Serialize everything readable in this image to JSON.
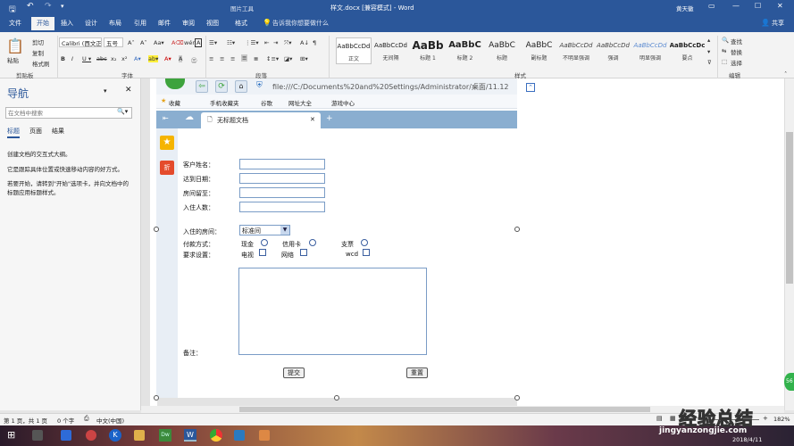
{
  "titlebar": {
    "quick_save": "🖫",
    "undo": "↶",
    "redo": "↷",
    "picture_tools": "图片工具",
    "doc_title": "样文.docx [兼容模式] - Word",
    "user": "黄天徽",
    "restore": "▭",
    "minimize": "—",
    "maximize": "☐",
    "close": "✕"
  },
  "tabs": {
    "file": "文件",
    "home": "开始",
    "insert": "插入",
    "design": "设计",
    "layout": "布局",
    "references": "引用",
    "mailings": "邮件",
    "review": "审阅",
    "view": "视图",
    "format": "格式",
    "tell_me": "告诉我你想要做什么",
    "share": "共享"
  },
  "ribbon": {
    "paste": "粘贴",
    "cut": "剪切",
    "copy": "复制",
    "format_painter": "格式刷",
    "clipboard": "剪贴板",
    "font_name": "Calibri (西文正",
    "font_size": "五号",
    "font_group": "字体",
    "paragraph_group": "段落",
    "styles_group": "样式",
    "editing_group": "编辑",
    "find": "查找",
    "replace": "替换",
    "select": "选择",
    "styles": [
      {
        "preview": "AaBbCcDd",
        "label": "正文"
      },
      {
        "preview": "AaBbCcDd",
        "label": "无间隔"
      },
      {
        "preview": "AaBb",
        "label": "标题 1"
      },
      {
        "preview": "AaBbC",
        "label": "标题 2"
      },
      {
        "preview": "AaBbC",
        "label": "标题"
      },
      {
        "preview": "AaBbC",
        "label": "副标题"
      },
      {
        "preview": "AaBbCcDd",
        "label": "不明显强调"
      },
      {
        "preview": "AaBbCcDd",
        "label": "强调"
      },
      {
        "preview": "AaBbCcDd",
        "label": "明显强调"
      },
      {
        "preview": "AaBbCcDc",
        "label": "要点"
      }
    ]
  },
  "nav": {
    "title": "导航",
    "search_placeholder": "在文档中搜索",
    "tab_headings": "标题",
    "tab_pages": "页面",
    "tab_results": "结果",
    "text1": "创建文档的交互式大纲。",
    "text2": "它是跟踪具体位置或快速移动内容的好方式。",
    "text3": "若要开始，请转到\"开始\"选项卡，并向文档中的标题应用标题样式。"
  },
  "browser": {
    "address": "file:///C:/Documents%20and%20Settings/Administrator/桌面/11.12",
    "fav_favorites": "收藏",
    "fav_mobile": "手机收藏夹",
    "fav_google": "谷歌",
    "fav_sites": "网址大全",
    "fav_games": "游戏中心",
    "tab_title": "无标题文档",
    "tab_close": "✕",
    "tab_new": "+"
  },
  "form": {
    "name_label": "客户姓名：",
    "arrival_label": "达到日期：",
    "room_label": "房间留至：",
    "guests_label": "入住人数：",
    "room_type_label": "入住的房间：",
    "room_type_value": "标准间",
    "payment_label": "付款方式：",
    "pay_cash": "现金",
    "pay_card": "信用卡",
    "pay_check": "支票",
    "req_label": "要求设置：",
    "req_tv": "电视",
    "req_net": "网络",
    "req_wc": "wcd",
    "notes_label": "备注：",
    "submit": "提交",
    "reset": "重置"
  },
  "status": {
    "page": "第 1 页，共 1 页",
    "words": "0 个字",
    "lang": "中文(中国)",
    "zoom": "182%"
  },
  "taskbar": {
    "watermark": "经验总结",
    "watermark_url": "jingyanzongjie.com",
    "date": "2018/4/11"
  },
  "colors": {
    "word_blue": "#2b579a",
    "ribbon_bg": "#f3f3f3"
  }
}
